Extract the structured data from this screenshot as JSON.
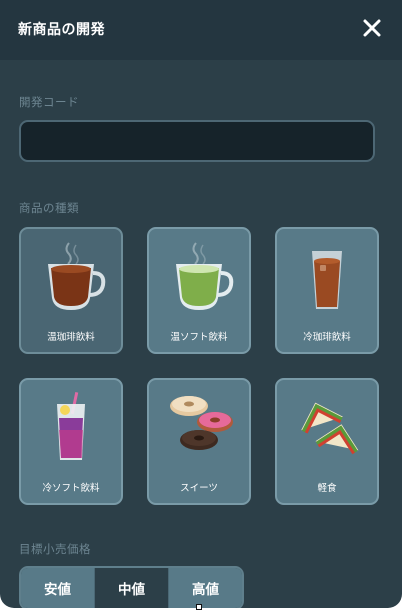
{
  "dialog": {
    "title": "新商品の開発",
    "close_icon": "close-icon"
  },
  "code_section": {
    "label": "開発コード",
    "value": "",
    "placeholder": ""
  },
  "type_section": {
    "label": "商品の種類",
    "items": [
      {
        "label": "温珈琲飲料",
        "icon": "hot-coffee-icon",
        "selected": true
      },
      {
        "label": "温ソフト飲料",
        "icon": "hot-matcha-icon",
        "selected": false
      },
      {
        "label": "冷珈琲飲料",
        "icon": "iced-coffee-icon",
        "selected": false
      },
      {
        "label": "冷ソフト飲料",
        "icon": "iced-soft-drink-icon",
        "selected": false
      },
      {
        "label": "スイーツ",
        "icon": "donuts-icon",
        "selected": false
      },
      {
        "label": "軽食",
        "icon": "sandwich-icon",
        "selected": false
      }
    ]
  },
  "price_section": {
    "label": "目標小売価格",
    "options": [
      "安値",
      "中値",
      "高値"
    ],
    "selected": "中値"
  },
  "colors": {
    "dialog_bg": "#2c3f48",
    "titlebar_bg": "#243640",
    "card_bg": "#587a88",
    "card_selected_bg": "#4a6673",
    "label_text": "#6d8591"
  }
}
